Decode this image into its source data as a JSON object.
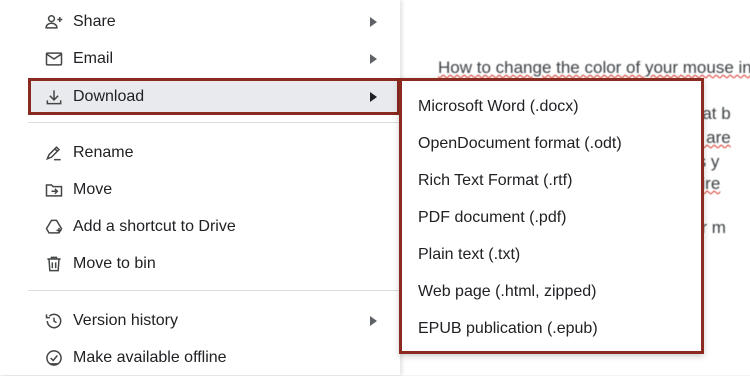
{
  "document": {
    "lines": [
      "How to change the color of your mouse in",
      "e that b",
      "use are",
      "n as y",
      "desire",
      "your m"
    ]
  },
  "file_menu": {
    "items": [
      {
        "id": "share",
        "label": "Share",
        "icon": "person-add-icon",
        "submenu": true
      },
      {
        "id": "email",
        "label": "Email",
        "icon": "email-icon",
        "submenu": true
      },
      {
        "id": "download",
        "label": "Download",
        "icon": "download-icon",
        "submenu": true,
        "highlighted": true
      },
      {
        "id": "rename",
        "label": "Rename",
        "icon": "rename-icon",
        "submenu": false
      },
      {
        "id": "move",
        "label": "Move",
        "icon": "move-folder-icon",
        "submenu": false
      },
      {
        "id": "shortcut",
        "label": "Add a shortcut to Drive",
        "icon": "drive-shortcut-icon",
        "submenu": false
      },
      {
        "id": "bin",
        "label": "Move to bin",
        "icon": "trash-icon",
        "submenu": false
      },
      {
        "id": "version",
        "label": "Version history",
        "icon": "history-icon",
        "submenu": true
      },
      {
        "id": "offline",
        "label": "Make available offline",
        "icon": "offline-check-icon",
        "submenu": false
      }
    ]
  },
  "download_submenu": {
    "items": [
      "Microsoft Word (.docx)",
      "OpenDocument format (.odt)",
      "Rich Text Format (.rtf)",
      "PDF document (.pdf)",
      "Plain text (.txt)",
      "Web page (.html, zipped)",
      "EPUB publication (.epub)"
    ]
  },
  "colors": {
    "highlight_border": "#8b2a1e",
    "hover_bg": "#e8eaed",
    "icon": "#444746",
    "spell_error": "#d93025"
  }
}
